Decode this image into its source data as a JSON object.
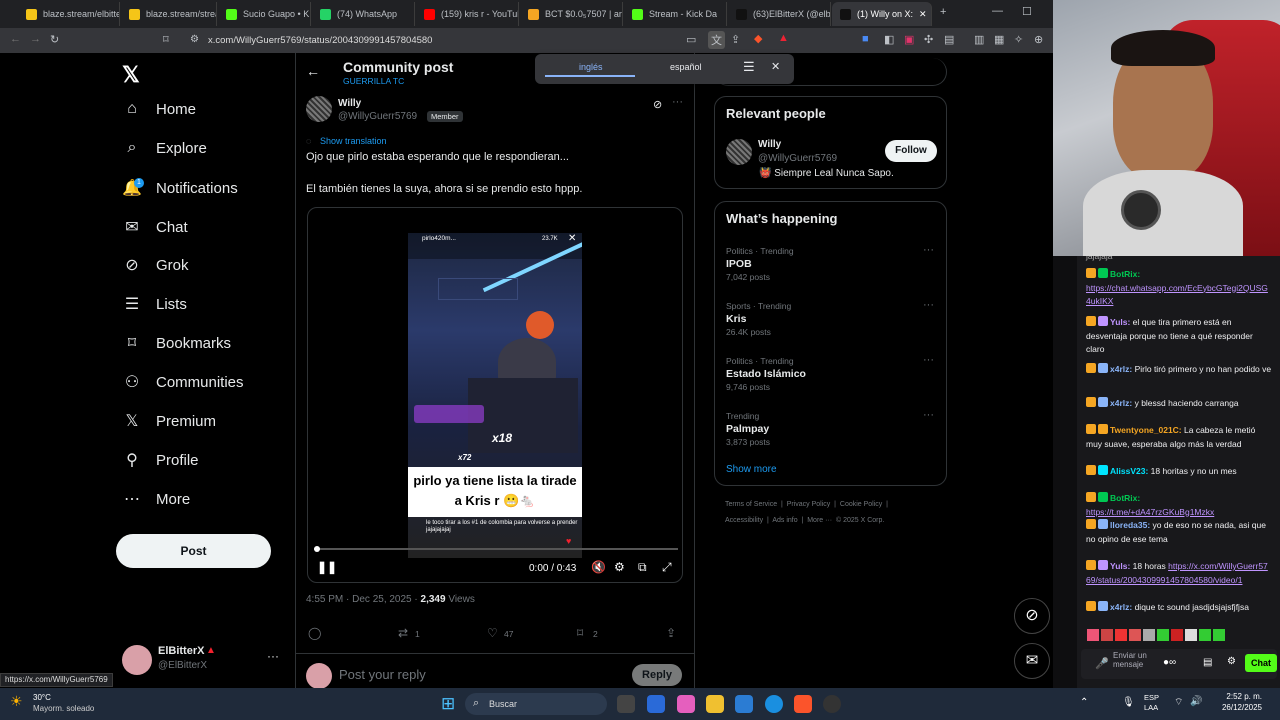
{
  "browser": {
    "tabs": [
      {
        "label": "blaze.stream/elbitte",
        "color": "#f5c518"
      },
      {
        "label": "blaze.stream/stream",
        "color": "#f5c518"
      },
      {
        "label": "Sucio Guapo • K",
        "color": "#53fc18"
      },
      {
        "label": "(74) WhatsApp",
        "color": "#25d366"
      },
      {
        "label": "(159) kris r - YouTub",
        "color": "#ff0000"
      },
      {
        "label": "BCT $0.0₅7507 | are",
        "color": "#f5a623"
      },
      {
        "label": "Stream - Kick Da",
        "color": "#53fc18"
      },
      {
        "label": "(63)ElBitterX (@elbi",
        "color": "#111111"
      },
      {
        "label": "(1) Willy on X:",
        "color": "#111111"
      }
    ],
    "url": "x.com/WillyGuerr5769/status/2004309991457804580"
  },
  "nav": {
    "items": [
      {
        "label": "Home",
        "icon": "home-icon",
        "glyph": "⌂"
      },
      {
        "label": "Explore",
        "icon": "search-icon",
        "glyph": "⌕"
      },
      {
        "label": "Notifications",
        "icon": "bell-icon",
        "glyph": "🔔"
      },
      {
        "label": "Chat",
        "icon": "mail-icon",
        "glyph": "✉"
      },
      {
        "label": "Grok",
        "icon": "grok-icon",
        "glyph": "⊘"
      },
      {
        "label": "Lists",
        "icon": "list-icon",
        "glyph": "☰"
      },
      {
        "label": "Bookmarks",
        "icon": "bookmark-icon",
        "glyph": "⌑"
      },
      {
        "label": "Communities",
        "icon": "communities-icon",
        "glyph": "⚇"
      },
      {
        "label": "Premium",
        "icon": "x-icon",
        "glyph": "𝕏"
      },
      {
        "label": "Profile",
        "icon": "person-icon",
        "glyph": "⚲"
      },
      {
        "label": "More",
        "icon": "more-icon",
        "glyph": "⋯"
      }
    ],
    "notifications_badge": "1",
    "post_label": "Post",
    "account_name": "ElBitterX",
    "account_handle": "@ElBitterX"
  },
  "header": {
    "title": "Community post",
    "subtitle": "GUERRILLA TC"
  },
  "translate": {
    "lang1": "inglés",
    "lang2": "español"
  },
  "post": {
    "author_name": "Willy",
    "author_handle": "@WillyGuerr5769",
    "member_badge": "Member",
    "show_translation": "Show translation",
    "text1": "Ojo que pirlo estaba esperando que le respondieran...",
    "text2": "El también tienes la suya, ahora si se prendio esto hppp.",
    "video_time": "0:00 / 0:43",
    "overlay_title": "pirlo ya tiene lista la tirade a Kris r 😬🐁",
    "overlay_x18": "x18",
    "overlay_x72": "x72",
    "overlay_caption": "le toco tirar a los #1 de colombia para volverse a prender jajajajajaj",
    "overlay_user": "pirlo420m...",
    "overlay_count": "23.7K",
    "timestamp": "4:55 PM · Dec 25, 2025 · ",
    "views_count": "2,349",
    "views_label": "Views",
    "retweets": "1",
    "likes": "47",
    "bookmarks": "2",
    "reply_placeholder": "Post your reply",
    "reply_button": "Reply"
  },
  "sidebar": {
    "relevant_title": "Relevant people",
    "person_name": "Willy",
    "person_handle": "@WillyGuerr5769",
    "person_bio": "👹 Siempre Leal Nunca Sapo.",
    "follow_label": "Follow",
    "happening_title": "What’s happening",
    "trends": [
      {
        "category": "Politics · Trending",
        "title": "IPOB",
        "posts": "7,042 posts"
      },
      {
        "category": "Sports · Trending",
        "title": "Kris",
        "posts": "26.4K posts"
      },
      {
        "category": "Politics · Trending",
        "title": "Estado Islámico",
        "posts": "9,746 posts"
      },
      {
        "category": "Trending",
        "title": "Palmpay",
        "posts": "3,873 posts"
      }
    ],
    "show_more": "Show more",
    "footer1": "Terms of Service  |  Privacy Policy  |  Cookie Policy  |",
    "footer2": "Accessibility  |  Ads info  |  More ···  © 2025 X Corp."
  },
  "chat": {
    "top_line": "jajajaja",
    "messages": [
      {
        "user": "BotRix:",
        "color": "#00c853",
        "text": "",
        "link": "https://chat.whatsapp.com/EcEybcGTegi2QUSG4ukIKX"
      },
      {
        "user": "Yuls:",
        "color": "#bf94ff",
        "text": " el que tira primero está en desventaja porque no tiene a qué responder claro",
        "link": ""
      },
      {
        "user": "x4rlz:",
        "color": "#8ab4f8",
        "text": " Pirlo tiró primero y no han podido ve",
        "link": ""
      },
      {
        "user": "x4rlz:",
        "color": "#8ab4f8",
        "text": " y blessd haciendo carranga",
        "link": ""
      },
      {
        "user": "Twentyone_021C:",
        "color": "#f5a623",
        "text": " La cabeza le metió muy suave, esperaba algo más la verdad",
        "link": ""
      },
      {
        "user": "AlissV23:",
        "color": "#00e5ff",
        "text": " 18 horitas y no un mes",
        "link": ""
      },
      {
        "user": "BotRix:",
        "color": "#00c853",
        "text": "",
        "link": "https://t.me/+dA47rzGKuBg1Mzkx"
      },
      {
        "user": "lloreda35:",
        "color": "#8ab4f8",
        "text": " yo de eso no se nada, asi que no opino de ese tema",
        "link": ""
      },
      {
        "user": "Yuls:",
        "color": "#bf94ff",
        "text": " 18 horas ",
        "link": "https://x.com/WillyGuerr5769/status/2004309991457804580/video/1"
      },
      {
        "user": "x4rlz:",
        "color": "#8ab4f8",
        "text": " dique tc sound jasdjdsjajsfjfjsa",
        "link": ""
      }
    ],
    "input_placeholder": "Enviar un mensaje",
    "chat_button": "Chat"
  },
  "status_url": "https://x.com/WillyGuerr5769",
  "taskbar": {
    "weather_temp": "30°C",
    "weather_desc": "Mayorm. soleado",
    "search": "Buscar",
    "lang": "ESP",
    "lang2": "LAA",
    "time": "2:52 p. m.",
    "date": "26/12/2025"
  }
}
